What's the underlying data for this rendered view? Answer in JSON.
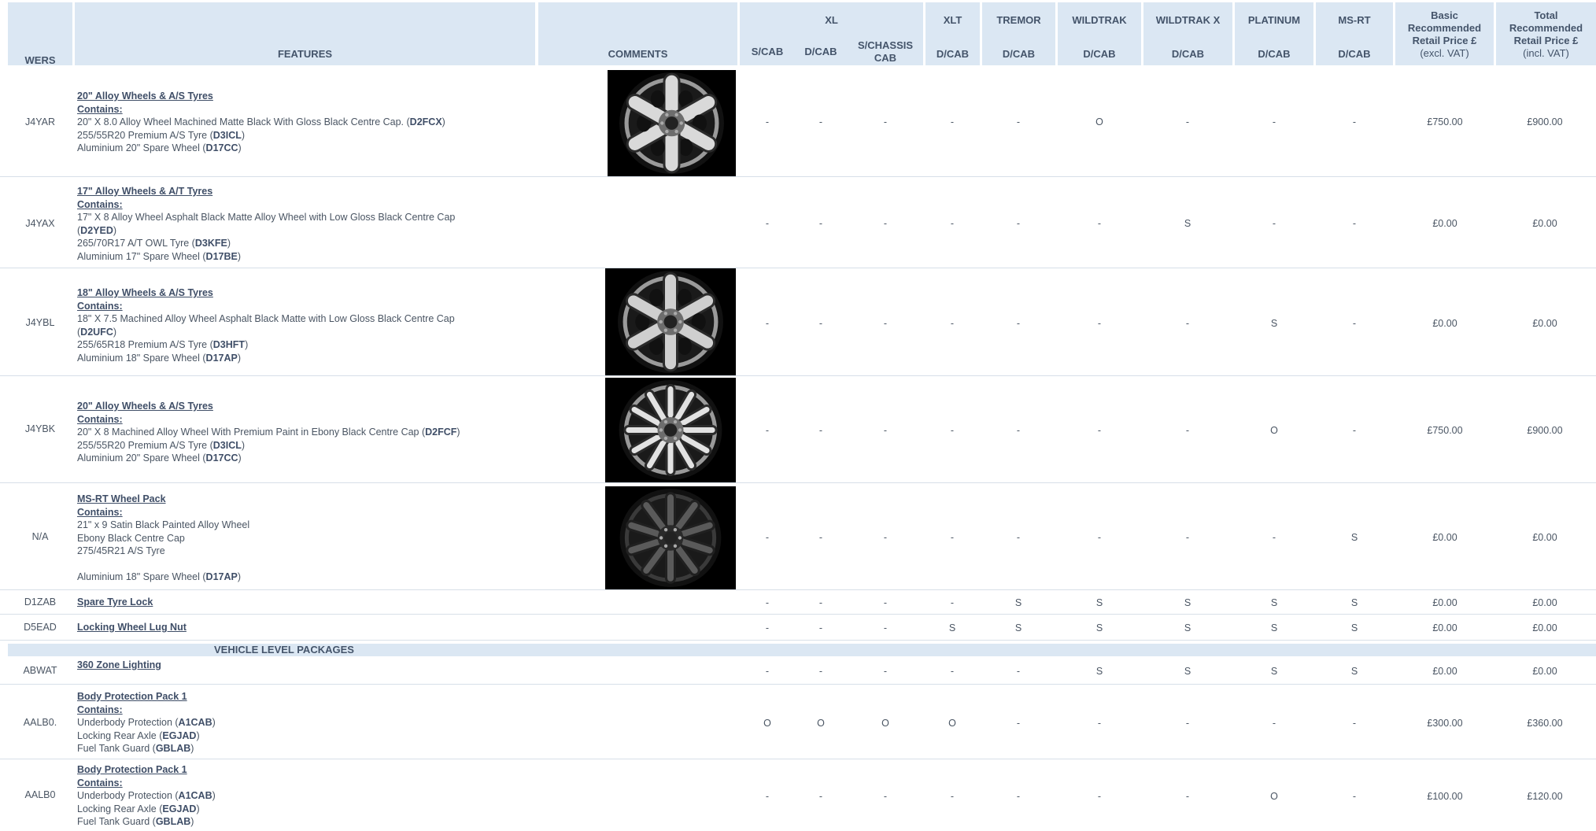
{
  "header": {
    "wers": "WERS",
    "features": "FEATURES",
    "comments": "COMMENTS",
    "groups": [
      {
        "name": "XL",
        "subs": [
          "S/CAB",
          "D/CAB",
          "S/CHASSIS CAB"
        ]
      },
      {
        "name": "XLT",
        "subs": [
          "D/CAB"
        ]
      },
      {
        "name": "TREMOR",
        "subs": [
          "D/CAB"
        ]
      },
      {
        "name": "WILDTRAK",
        "subs": [
          "D/CAB"
        ]
      },
      {
        "name": "WILDTRAK X",
        "subs": [
          "D/CAB"
        ]
      },
      {
        "name": "PLATINUM",
        "subs": [
          "D/CAB"
        ]
      },
      {
        "name": "MS-RT",
        "subs": [
          "D/CAB"
        ]
      }
    ],
    "basic_price": {
      "l1": "Basic",
      "l2": "Recommended",
      "l3": "Retail Price £",
      "l4": "(excl. VAT)"
    },
    "total_price": {
      "l1": "Total",
      "l2": "Recommended",
      "l3": "Retail Price £",
      "l4": "(incl. VAT)"
    }
  },
  "rows": [
    {
      "wers": "J4YAR",
      "title": "20\" Alloy Wheels & A/S Tyres",
      "contains": "Contains:",
      "lines": [
        [
          "20\" X 8.0 Alloy Wheel Machined Matte Black With Gloss Black Centre Cap. (",
          "D2FCX",
          ")"
        ],
        [
          "255/55R20 Premium A/S Tyre (",
          "D3ICL",
          ")"
        ],
        [
          "Aluminium 20\" Spare Wheel (",
          "D17CC",
          ")"
        ]
      ],
      "wheel_image": "wheel-photo-6-spoke-machined",
      "values": [
        "-",
        "-",
        "-",
        "-",
        "-",
        "O",
        "-",
        "-",
        "-"
      ],
      "basic": "£750.00",
      "total": "£900.00"
    },
    {
      "wers": "J4YAX",
      "title": "17\" Alloy Wheels & A/T Tyres",
      "contains": "Contains:",
      "lines": [
        [
          "17\" X 8 Alloy Wheel Asphalt Black Matte Alloy Wheel with Low Gloss Black Centre Cap",
          "",
          ""
        ],
        [
          "(",
          "D2YED",
          ")"
        ],
        [
          "265/70R17 A/T OWL Tyre (",
          "D3KFE",
          ")"
        ],
        [
          "Aluminium 17\" Spare Wheel (",
          "D17BE",
          ")"
        ]
      ],
      "wheel_image": "",
      "values": [
        "-",
        "-",
        "-",
        "-",
        "-",
        "-",
        "S",
        "-",
        "-"
      ],
      "basic": "£0.00",
      "total": "£0.00"
    },
    {
      "wers": "J4YBL",
      "title": "18\" Alloy Wheels & A/S Tyres",
      "contains": "Contains:",
      "lines": [
        [
          "18\" X 7.5 Machined Alloy Wheel Asphalt Black Matte with Low Gloss Black Centre Cap",
          "",
          ""
        ],
        [
          "(",
          "D2UFC",
          ")"
        ],
        [
          "255/65R18 Premium A/S Tyre (",
          "D3HFT",
          ")"
        ],
        [
          "Aluminium 18\" Spare Wheel (",
          "D17AP",
          ")"
        ]
      ],
      "wheel_image": "wheel-photo-6-spoke-asphalt",
      "values": [
        "-",
        "-",
        "-",
        "-",
        "-",
        "-",
        "-",
        "S",
        "-"
      ],
      "basic": "£0.00",
      "total": "£0.00"
    },
    {
      "wers": "J4YBK",
      "title": "20\" Alloy Wheels & A/S Tyres",
      "contains": "Contains:",
      "lines": [
        [
          "20\" X 8 Machined Alloy Wheel  With Premium Paint in Ebony Black Centre Cap  (",
          "D2FCF",
          ")"
        ],
        [
          "255/55R20 Premium A/S Tyre (",
          "D3ICL",
          ")"
        ],
        [
          "Aluminium 20\" Spare Wheel (",
          "D17CC",
          ")"
        ]
      ],
      "wheel_image": "wheel-photo-split-spoke-premium",
      "values": [
        "-",
        "-",
        "-",
        "-",
        "-",
        "-",
        "-",
        "O",
        "-"
      ],
      "basic": "£750.00",
      "total": "£900.00"
    },
    {
      "wers": "N/A",
      "title": "MS-RT Wheel Pack",
      "contains": "Contains:",
      "lines": [
        [
          "21\" x 9 Satin Black Painted Alloy Wheel",
          "",
          ""
        ],
        [
          "Ebony Black Centre Cap",
          "",
          ""
        ],
        [
          "275/45R21 A/S Tyre",
          "",
          ""
        ],
        [
          "",
          "",
          ""
        ],
        [
          "Aluminium 18\" Spare Wheel (",
          "D17AP",
          ")"
        ]
      ],
      "wheel_image": "wheel-photo-ms-rt-satin-black",
      "values": [
        "-",
        "-",
        "-",
        "-",
        "-",
        "-",
        "-",
        "-",
        "S"
      ],
      "basic": "£0.00",
      "total": "£0.00"
    },
    {
      "wers": "D1ZAB",
      "title": "Spare Tyre Lock",
      "contains": "",
      "lines": [],
      "wheel_image": "",
      "values": [
        "-",
        "-",
        "-",
        "-",
        "S",
        "S",
        "S",
        "S",
        "S"
      ],
      "basic": "£0.00",
      "total": "£0.00"
    },
    {
      "wers": "D5EAD",
      "title": "Locking Wheel Lug Nut",
      "contains": "",
      "lines": [],
      "wheel_image": "",
      "values": [
        "-",
        "-",
        "-",
        "S",
        "S",
        "S",
        "S",
        "S",
        "S"
      ],
      "basic": "£0.00",
      "total": "£0.00"
    }
  ],
  "section_label": "VEHICLE LEVEL PACKAGES",
  "package_rows": [
    {
      "wers": "ABWAT",
      "title": "360 Zone Lighting",
      "contains": "",
      "lines": [],
      "values": [
        "-",
        "-",
        "-",
        "-",
        "-",
        "S",
        "S",
        "S",
        "S"
      ],
      "basic": "£0.00",
      "total": "£0.00"
    },
    {
      "wers": "AALB0.",
      "title": "Body Protection Pack 1",
      "contains": "Contains:",
      "lines": [
        [
          "Underbody Protection (",
          "A1CAB",
          ")"
        ],
        [
          "Locking Rear Axle (",
          "EGJAD",
          ")"
        ],
        [
          "Fuel Tank Guard (",
          "GBLAB",
          ")"
        ]
      ],
      "values": [
        "O",
        "O",
        "O",
        "O",
        "-",
        "-",
        "-",
        "-",
        "-"
      ],
      "basic": "£300.00",
      "total": "£360.00"
    },
    {
      "wers": "AALB0",
      "title": "Body Protection Pack 1",
      "contains": "Contains:",
      "lines": [
        [
          "Underbody Protection (",
          "A1CAB",
          ")"
        ],
        [
          "Locking Rear Axle (",
          "EGJAD",
          ")"
        ],
        [
          "Fuel Tank Guard (",
          "GBLAB",
          ")"
        ]
      ],
      "values": [
        "-",
        "-",
        "-",
        "-",
        "-",
        "-",
        "-",
        "O",
        "-"
      ],
      "basic": "£100.00",
      "total": "£120.00"
    }
  ],
  "colors": {
    "header_bg": "#dbe7f3",
    "text": "#4a5563",
    "title": "#3f4e67"
  }
}
